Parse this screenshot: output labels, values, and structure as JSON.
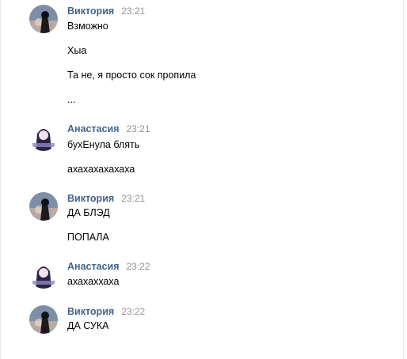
{
  "messages": [
    {
      "author": "Виктория",
      "time": "23:21",
      "avatar": "victoria-avatar-icon",
      "lines": [
        "Взможно",
        "Хыа",
        "Та не, я просто сок пропила",
        "..."
      ]
    },
    {
      "author": "Анастасия",
      "time": "23:21",
      "avatar": "anastasia-avatar-icon",
      "lines": [
        "бухЕнула блять",
        "ахахахахахаха"
      ]
    },
    {
      "author": "Виктория",
      "time": "23:21",
      "avatar": "victoria-avatar-icon",
      "lines": [
        "ДА БЛЭД",
        "ПОПАЛА"
      ]
    },
    {
      "author": "Анастасия",
      "time": "23:22",
      "avatar": "anastasia-avatar-icon",
      "lines": [
        "ахахаххаха"
      ]
    },
    {
      "author": "Виктория",
      "time": "23:22",
      "avatar": "victoria-avatar-icon",
      "lines": [
        "ДА СУКА"
      ]
    }
  ],
  "colors": {
    "author": "#42648b",
    "time": "#939393",
    "text": "#000000"
  }
}
